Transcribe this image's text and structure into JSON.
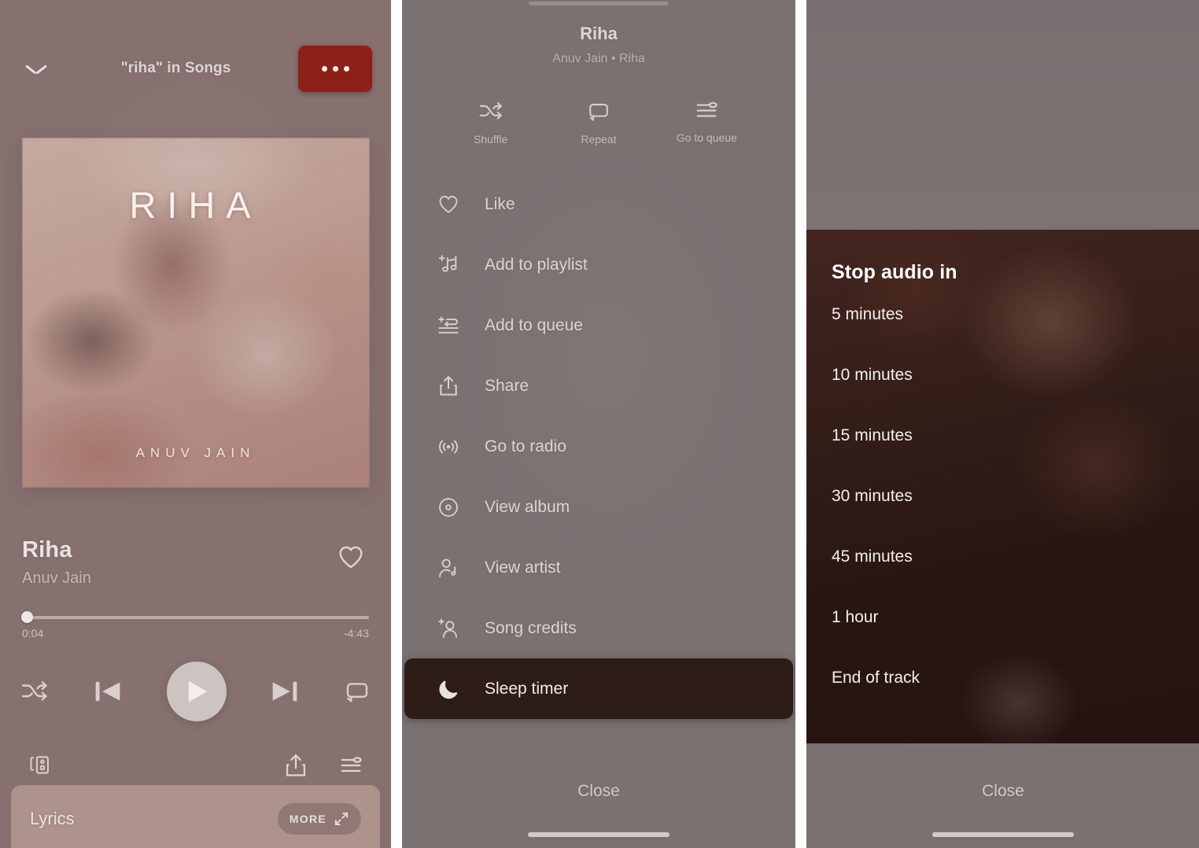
{
  "colors": {
    "panel1_bg": "#867070",
    "panel2_bg": "#7a7271",
    "panel3_bg": "#7a7271",
    "accent_highlight_red": "#8c1f18",
    "sleep_timer_highlight": "#2e1c19",
    "lyrics_card_bg": "#ad938c",
    "play_button": "#cdc4c2"
  },
  "panel1": {
    "name": "now-playing-screen",
    "header": {
      "collapse_icon": "chevron-down-icon",
      "title": "\"riha\" in Songs",
      "more_icon": "more-options-icon"
    },
    "album_art": {
      "title": "RIHA",
      "artist": "ANUV JAIN"
    },
    "track": {
      "name": "Riha",
      "artist": "Anuv Jain",
      "like_icon": "heart-icon"
    },
    "progress": {
      "elapsed": "0:04",
      "remaining": "-4:43",
      "percent": 1.3
    },
    "controls": {
      "shuffle_icon": "shuffle-icon",
      "previous_icon": "previous-track-icon",
      "play_icon": "play-icon",
      "next_icon": "next-track-icon",
      "repeat_icon": "repeat-icon"
    },
    "bottom_bar": {
      "devices_icon": "connect-to-device-icon",
      "share_icon": "share-icon",
      "queue_icon": "queue-icon"
    },
    "lyrics_card": {
      "label": "Lyrics",
      "more_label": "MORE",
      "expand_icon": "expand-diagonal-icon"
    }
  },
  "panel2": {
    "name": "track-context-menu",
    "header": {
      "title": "Riha",
      "subtitle": "Anuv Jain • Riha"
    },
    "quick_actions": [
      {
        "label": "Shuffle",
        "icon": "shuffle-icon"
      },
      {
        "label": "Repeat",
        "icon": "repeat-icon"
      },
      {
        "label": "Go to queue",
        "icon": "queue-icon"
      }
    ],
    "menu_items": [
      {
        "label": "Like",
        "icon": "heart-icon",
        "highlighted": false
      },
      {
        "label": "Add to playlist",
        "icon": "add-to-playlist-icon",
        "highlighted": false
      },
      {
        "label": "Add to queue",
        "icon": "add-to-queue-icon",
        "highlighted": false
      },
      {
        "label": "Share",
        "icon": "share-icon",
        "highlighted": false
      },
      {
        "label": "Go to radio",
        "icon": "radio-icon",
        "highlighted": false
      },
      {
        "label": "View album",
        "icon": "album-disc-icon",
        "highlighted": false
      },
      {
        "label": "View artist",
        "icon": "artist-icon",
        "highlighted": false
      },
      {
        "label": "Song credits",
        "icon": "song-credits-icon",
        "highlighted": false
      },
      {
        "label": "Sleep timer",
        "icon": "moon-icon",
        "highlighted": true
      }
    ],
    "close_label": "Close"
  },
  "panel3": {
    "name": "sleep-timer-sheet",
    "title": "Stop audio in",
    "options": [
      "5 minutes",
      "10 minutes",
      "15 minutes",
      "30 minutes",
      "45 minutes",
      "1 hour",
      "End of track"
    ],
    "close_label": "Close"
  }
}
